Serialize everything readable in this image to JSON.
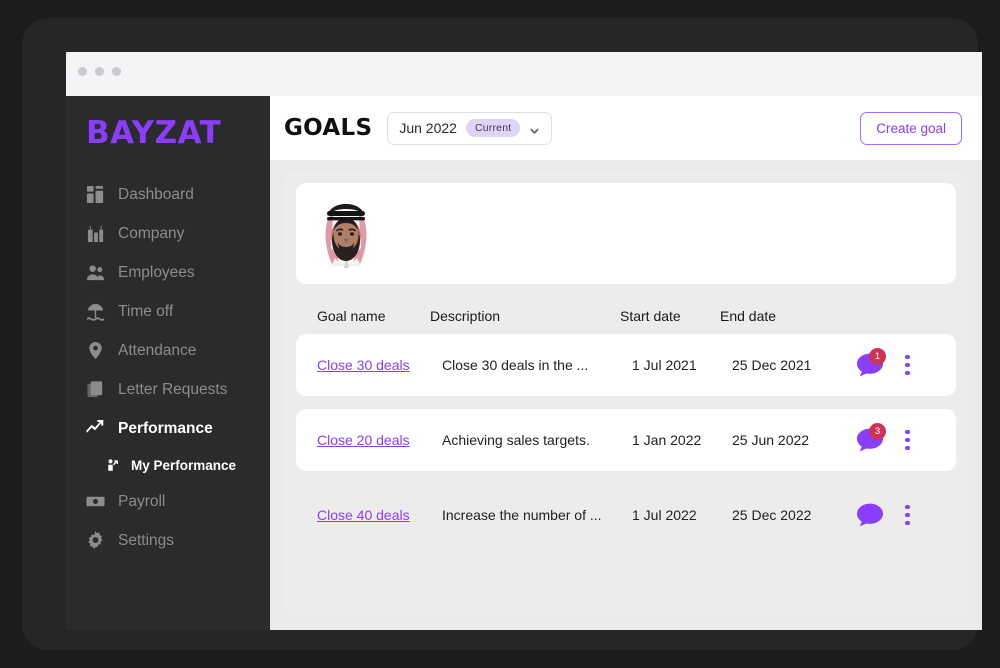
{
  "window": {
    "traffic_lights": [
      "close",
      "minimize",
      "maximize"
    ]
  },
  "sidebar": {
    "logo": "BAYZAT",
    "items": [
      {
        "label": "Dashboard",
        "icon": "dashboard-icon",
        "active": false
      },
      {
        "label": "Company",
        "icon": "company-icon",
        "active": false
      },
      {
        "label": "Employees",
        "icon": "employees-icon",
        "active": false
      },
      {
        "label": "Time off",
        "icon": "time-off-icon",
        "active": false
      },
      {
        "label": "Attendance",
        "icon": "location-pin-icon",
        "active": false
      },
      {
        "label": "Letter Requests",
        "icon": "document-icon",
        "active": false
      },
      {
        "label": "Performance",
        "icon": "trend-arrow-icon",
        "active": true
      },
      {
        "label": "My Performance",
        "icon": "person-arrow-icon",
        "active": true,
        "sub": true
      },
      {
        "label": "Payroll",
        "icon": "banknote-icon",
        "active": false
      },
      {
        "label": "Settings",
        "icon": "gear-icon",
        "active": false
      }
    ]
  },
  "header": {
    "title": "GOALS",
    "date_value": "Jun 2022",
    "date_badge": "Current",
    "create_label": "Create goal"
  },
  "profile": {
    "avatar_alt": "employee-portrait"
  },
  "table": {
    "columns": [
      "Goal name",
      "Description",
      "Start date",
      "End date"
    ],
    "rows": [
      {
        "name": "Close 30 deals",
        "description": "Close 30 deals in the ...",
        "start": "1 Jul 2021",
        "end": "25 Dec 2021",
        "comments": "1",
        "card": true
      },
      {
        "name": "Close 20 deals",
        "description": "Achieving sales targets.",
        "start": "1 Jan 2022",
        "end": "25 Jun 2022",
        "comments": "3",
        "card": true
      },
      {
        "name": "Close 40 deals",
        "description": "Increase the number of ...",
        "start": "1 Jul 2022",
        "end": "25 Dec 2022",
        "comments": "",
        "card": false
      }
    ]
  },
  "colors": {
    "accent_purple": "#8a3dfb",
    "badge_red": "#cc3355",
    "badge_lavender": "#ded4f7",
    "sidebar_bg": "#2b2b2b",
    "content_bg": "#eaeaea"
  }
}
